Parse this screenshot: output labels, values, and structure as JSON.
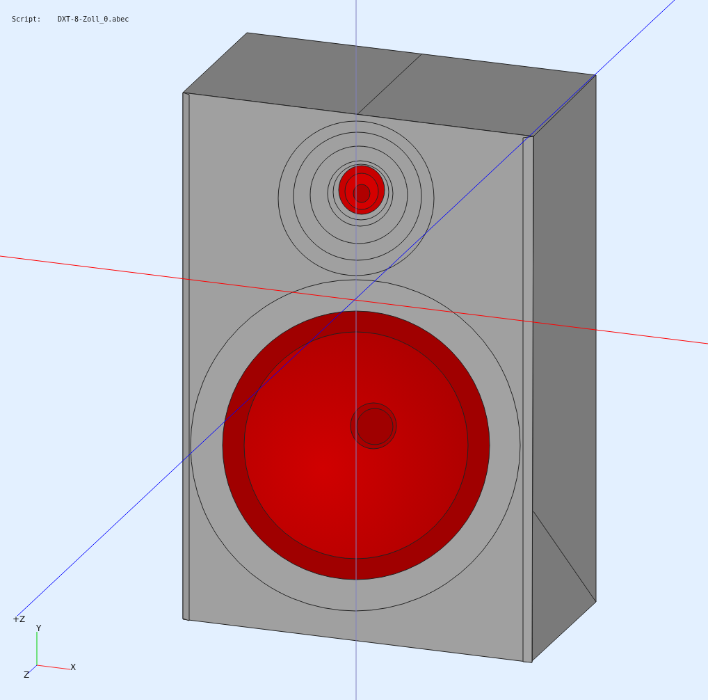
{
  "script": {
    "label": "Script:",
    "file": "DXT-8-Zoll_0.abec"
  },
  "axes": {
    "z_label": "+Z"
  },
  "orientation_triad": {
    "x": "X",
    "y": "Y",
    "z": "Z"
  }
}
